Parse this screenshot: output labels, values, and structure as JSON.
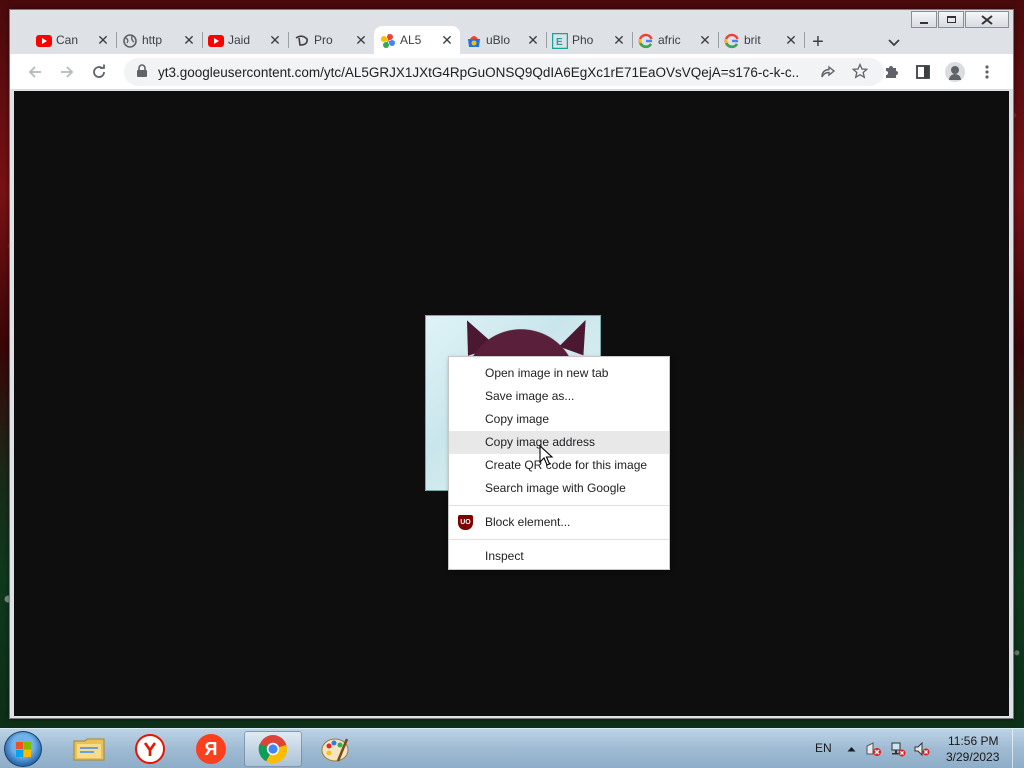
{
  "window": {
    "controls": [
      "minimize",
      "maximize",
      "close"
    ]
  },
  "tabs": [
    {
      "label": "Can",
      "favicon": "youtube-icon",
      "active": false
    },
    {
      "label": "http",
      "favicon": "globe-icon",
      "active": false
    },
    {
      "label": "Jaid",
      "favicon": "youtube-icon",
      "active": false
    },
    {
      "label": "Pro",
      "favicon": "disney-icon",
      "active": false
    },
    {
      "label": "AL5",
      "favicon": "google-photos-icon",
      "active": true
    },
    {
      "label": "uBlo",
      "favicon": "chrome-store-icon",
      "active": false
    },
    {
      "label": "Pho",
      "favicon": "photopea-icon",
      "active": false
    },
    {
      "label": "afric",
      "favicon": "google-icon",
      "active": false
    },
    {
      "label": "brit",
      "favicon": "google-icon",
      "active": false
    }
  ],
  "toolbar": {
    "url": "yt3.googleusercontent.com/ytc/AL5GRJX1JXtG4RpGuONSQ9QdIA6EgXc1rE71EaOVsVQejA=s176-c-k-c...",
    "lock_icon": "lock-icon"
  },
  "context_menu": {
    "items": [
      {
        "label": "Open image in new tab"
      },
      {
        "label": "Save image as..."
      },
      {
        "label": "Copy image"
      },
      {
        "label": "Copy image address",
        "hovered": true
      },
      {
        "label": "Create QR code for this image"
      },
      {
        "label": "Search image with Google"
      }
    ],
    "extension_item": {
      "label": "Block element...",
      "icon": "ublock-origin-icon",
      "icon_text": "UO"
    },
    "inspect_item": {
      "label": "Inspect"
    }
  },
  "taskbar": {
    "apps": [
      {
        "name": "file-explorer",
        "icon": "folder-icon"
      },
      {
        "name": "yandex-browser",
        "icon": "yandex-icon"
      },
      {
        "name": "yandex",
        "icon": "yandex-letter-icon",
        "glyph": "Я"
      },
      {
        "name": "google-chrome",
        "icon": "chrome-icon",
        "active": true
      },
      {
        "name": "paint",
        "icon": "paint-icon"
      }
    ],
    "language": "EN",
    "time": "11:56 PM",
    "date": "3/29/2023"
  },
  "colors": {
    "youtube_red": "#ff0000",
    "chrome_blue": "#1a73e8",
    "ublock_red": "#800000",
    "taskbar": "#9fbbd3"
  }
}
